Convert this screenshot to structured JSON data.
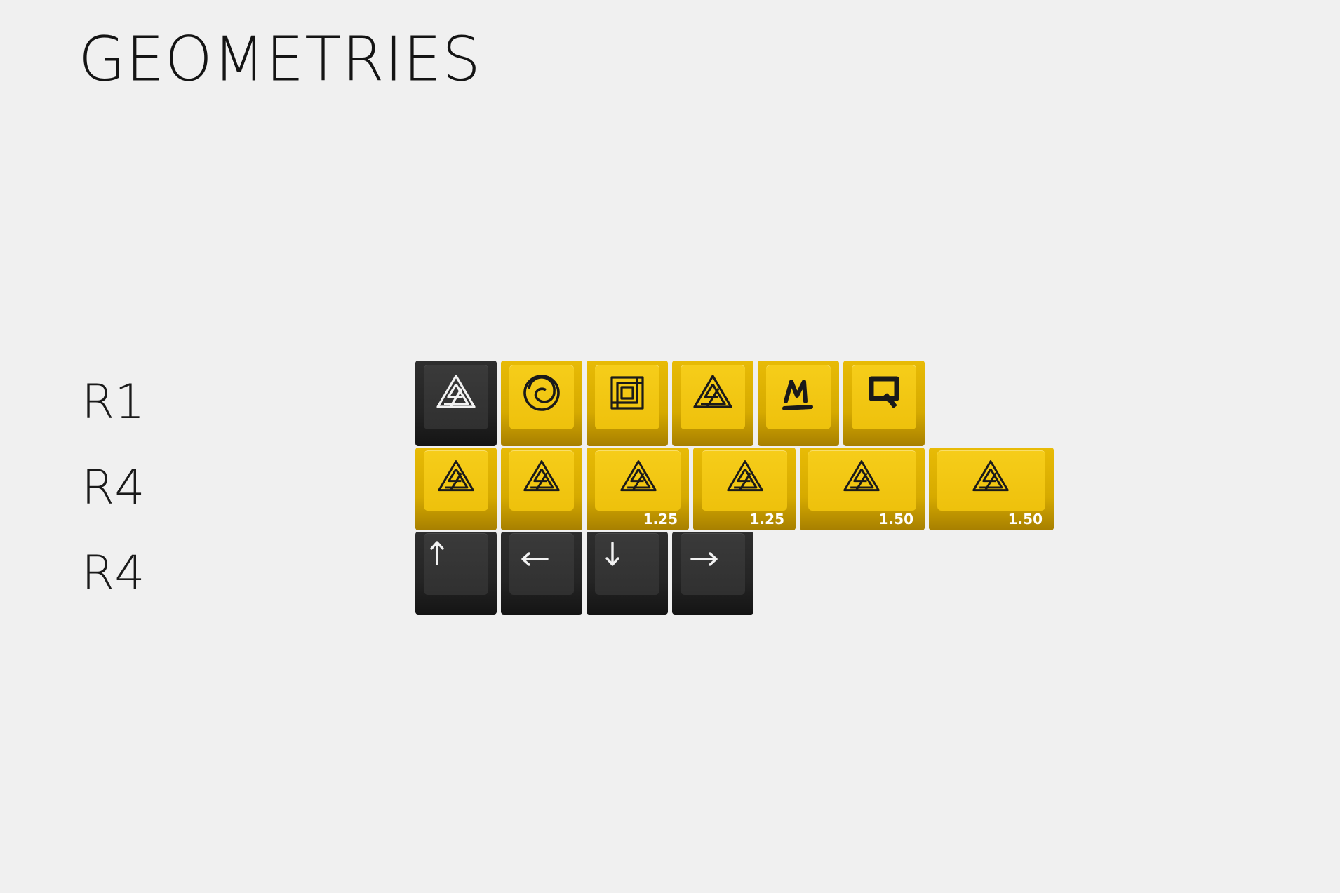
{
  "title": "GEOMETRIES",
  "rows": [
    {
      "label": "R1"
    },
    {
      "label": "R4"
    },
    {
      "label": "R4"
    }
  ],
  "colors": {
    "yellow": "#f0c20f",
    "dark": "#2a2a2a",
    "legend_dark": "#1a1a1a",
    "legend_light": "#f2f2f2",
    "background": "#f0f0f0"
  },
  "keycaps": {
    "row1": [
      {
        "color": "dark",
        "icon": "penrose-triangle-icon"
      },
      {
        "color": "yellow",
        "icon": "circle-swirl-icon"
      },
      {
        "color": "yellow",
        "icon": "impossible-square-icon"
      },
      {
        "color": "yellow",
        "icon": "penrose-triangle-icon"
      },
      {
        "color": "yellow",
        "icon": "letter-m-icon"
      },
      {
        "color": "yellow",
        "icon": "letter-q-icon"
      }
    ],
    "row2": [
      {
        "color": "yellow",
        "icon": "penrose-triangle-icon",
        "size": ""
      },
      {
        "color": "yellow",
        "icon": "penrose-triangle-icon",
        "size": ""
      },
      {
        "color": "yellow",
        "icon": "penrose-triangle-icon",
        "size": "1.25"
      },
      {
        "color": "yellow",
        "icon": "penrose-triangle-icon",
        "size": "1.25"
      },
      {
        "color": "yellow",
        "icon": "penrose-triangle-icon",
        "size": "1.50"
      },
      {
        "color": "yellow",
        "icon": "penrose-triangle-icon",
        "size": "1.50"
      }
    ],
    "row3": [
      {
        "color": "dark",
        "icon": "arrow-up-icon"
      },
      {
        "color": "dark",
        "icon": "arrow-left-icon"
      },
      {
        "color": "dark",
        "icon": "arrow-down-icon"
      },
      {
        "color": "dark",
        "icon": "arrow-right-icon"
      }
    ]
  }
}
